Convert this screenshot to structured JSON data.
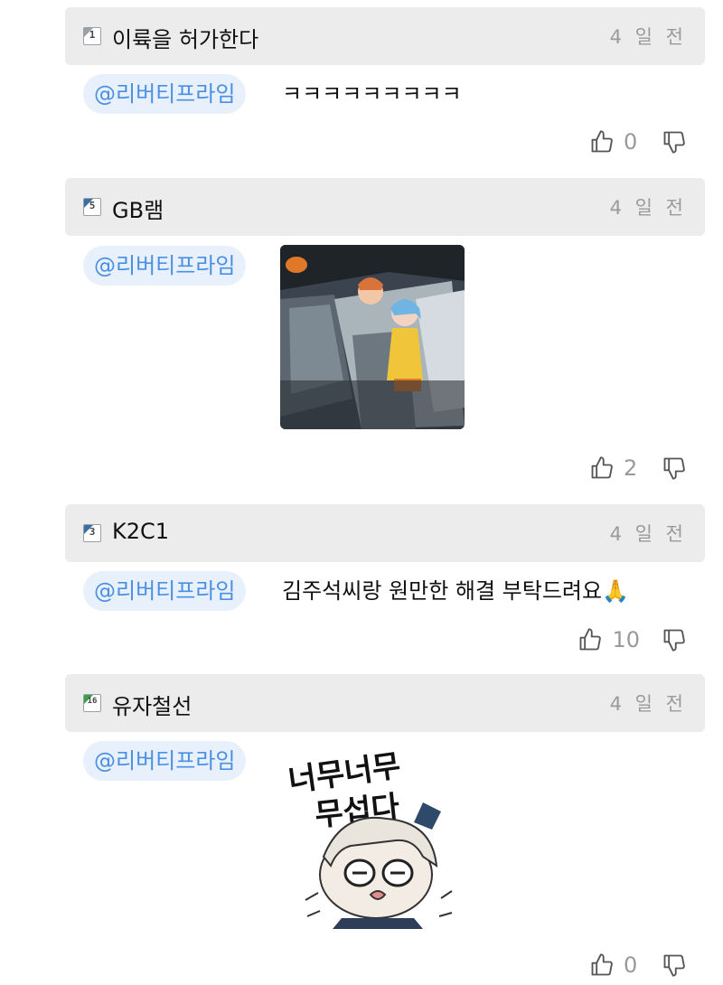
{
  "comments": [
    {
      "level": "1",
      "nickname": "이륙을 허가한다",
      "time": "4 일 전",
      "mention": "@리버티프라임",
      "text": "ㅋㅋㅋㅋㅋㅋㅋㅋㅋ",
      "likes": "0"
    },
    {
      "level": "5",
      "nickname": "GB램",
      "time": "4 일 전",
      "mention": "@리버티프라임",
      "text": "",
      "likes": "2"
    },
    {
      "level": "3",
      "nickname": "K2C1",
      "time": "4 일 전",
      "mention": "@리버티프라임",
      "text": "김주석씨랑 원만한 해결 부탁드려요🙏",
      "likes": "10"
    },
    {
      "level": "16",
      "nickname": "유자철선",
      "time": "4 일 전",
      "mention": "@리버티프라임",
      "sticker_text_1": "너무너무",
      "sticker_text_2": "무섭다",
      "likes": "0"
    }
  ],
  "icons": {
    "like": "thumbs-up-icon",
    "dislike": "thumbs-down-icon"
  },
  "colors": {
    "header_bg": "#ececec",
    "mention_bg": "#e8f1fb",
    "mention_text": "#4a90e2",
    "level_badge": "#3a6ea5"
  }
}
